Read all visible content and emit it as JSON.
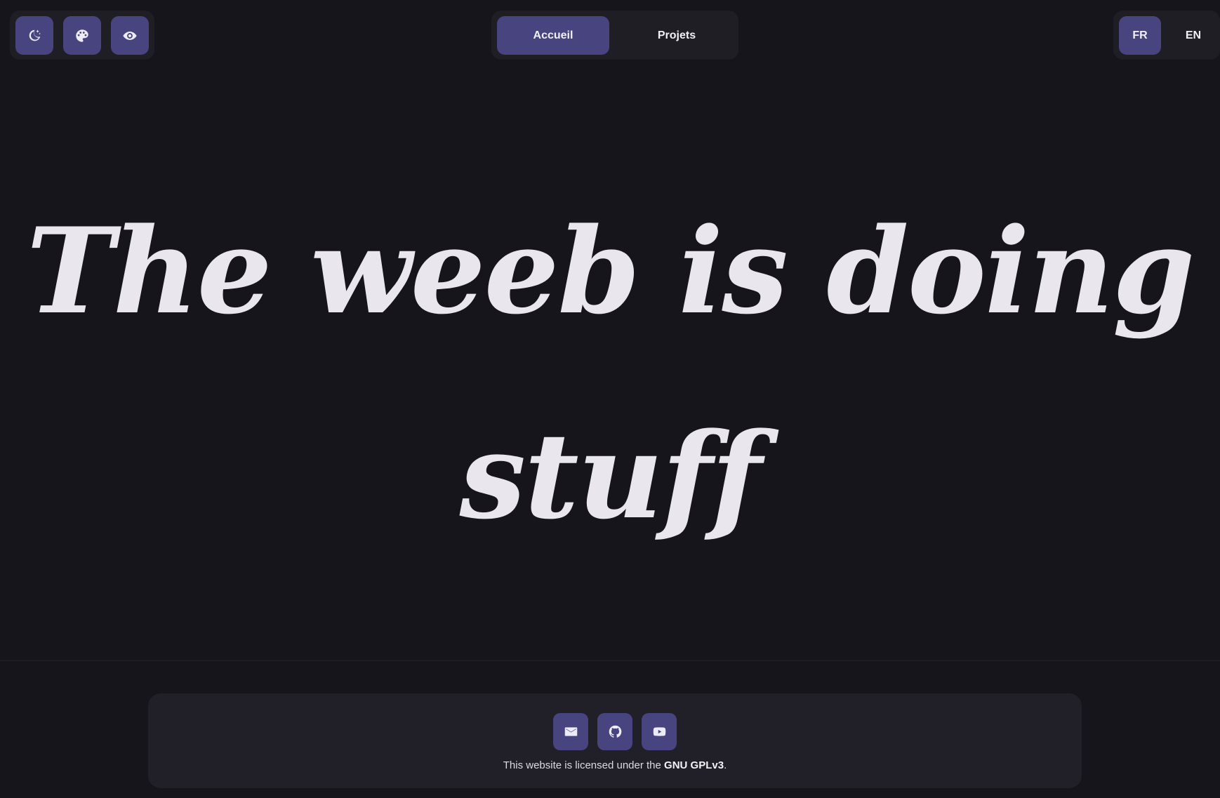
{
  "toolbar": {
    "left_buttons": [
      {
        "icon": "moon-stars-icon"
      },
      {
        "icon": "palette-icon"
      },
      {
        "icon": "eye-icon"
      }
    ],
    "nav_tabs": [
      {
        "label": "Accueil",
        "active": true
      },
      {
        "label": "Projets",
        "active": false
      }
    ],
    "languages": [
      {
        "label": "FR",
        "active": true
      },
      {
        "label": "EN",
        "active": false
      }
    ]
  },
  "hero": {
    "line1": "The weeb is doing",
    "line2": "stuff"
  },
  "footer": {
    "social": [
      {
        "icon": "mail-icon"
      },
      {
        "icon": "github-icon"
      },
      {
        "icon": "youtube-icon"
      }
    ],
    "license_prefix": "This website is licensed under the ",
    "license_name": "GNU GPLv3",
    "license_suffix": "."
  },
  "colors": {
    "background": "#16151c",
    "panel": "#1f1e25",
    "accent": "#48447f",
    "text": "#e9e6ee"
  }
}
